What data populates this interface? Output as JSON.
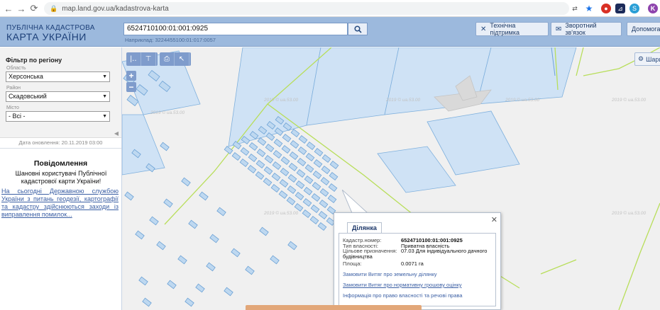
{
  "browser": {
    "url": "map.land.gov.ua/kadastrova-karta",
    "profile_initial": "K"
  },
  "header": {
    "logo_line1": "ПУБЛІЧНА КАДАСТРОВА",
    "logo_line2": "КАРТА УКРАЇНИ",
    "search_value": "6524710100:01:001:0925",
    "search_hint": "Наприклад: 3224455100:01:017:0057",
    "btn_support": "Технічна підтримка",
    "btn_feedback": "Зворотний зв'язок",
    "btn_help": "Допомога"
  },
  "sidebar": {
    "filter_title": "Фільтр по регіону",
    "oblast_label": "Область",
    "oblast_value": "Херсонська",
    "rayon_label": "Район",
    "rayon_value": "Скадовський",
    "city_label": "Місто",
    "city_value": "- Всі -",
    "update_date": "Дата оновлення: 20.11.2019 03:00",
    "notice_title": "Повідомлення",
    "notice_text": "Шановні користувачі Публічної кадастрової карти України!",
    "notice_link": "На сьогодні Державною службою України з питань геодезії, картографії та кадастру здійснюються заходи із виправлення помилок..."
  },
  "map": {
    "layers_label": "Шари",
    "tile_label": "2019 © ua.53.00"
  },
  "popup": {
    "tab": "Ділянка",
    "rows": [
      {
        "key": "Кадастр.номер:",
        "value": "6524710100:01:001:0925"
      },
      {
        "key": "Тип власності:",
        "value": "Приватна власність"
      },
      {
        "key": "Цільове призначення:",
        "value": "07.03 Для індивідуального дачного будівництва"
      },
      {
        "key": "Площа:",
        "value": "0.0071 га"
      }
    ],
    "link1": "Замовити Витяг про земельну ділянку",
    "link2": "Замовити Витяг про нормативну грошову оцінку",
    "link3": "Інформація про право власності та речові права"
  },
  "colors": {
    "header_bg": "#9cb9dd",
    "parcel_fill": "#bed8f0",
    "parcel_stroke": "#6ea3d6",
    "boundary": "#b8de5a"
  }
}
